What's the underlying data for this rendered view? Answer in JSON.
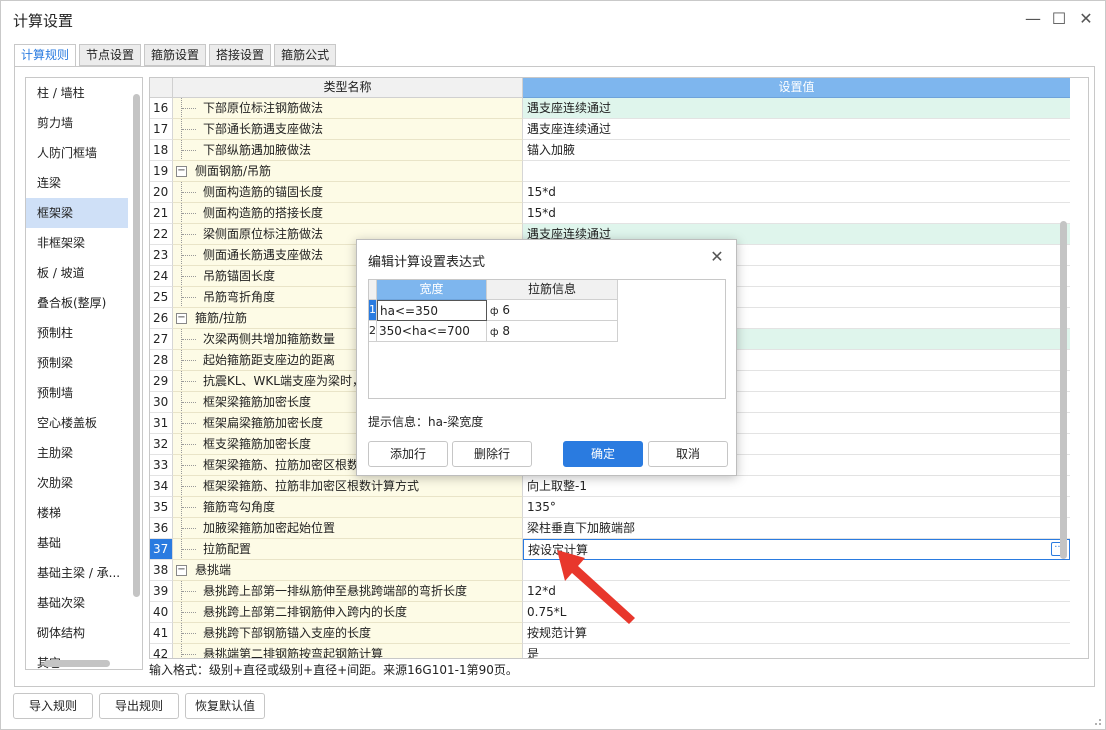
{
  "window": {
    "title": "计算设置",
    "minimize": "—",
    "maximize": "☐",
    "close": "✕"
  },
  "tabs": [
    {
      "label": "计算规则",
      "active": true
    },
    {
      "label": "节点设置",
      "active": false
    },
    {
      "label": "箍筋设置",
      "active": false
    },
    {
      "label": "搭接设置",
      "active": false
    },
    {
      "label": "箍筋公式",
      "active": false
    }
  ],
  "sidebar": {
    "items": [
      "柱 / 墙柱",
      "剪力墙",
      "人防门框墙",
      "连梁",
      "框架梁",
      "非框架梁",
      "板 / 坡道",
      "叠合板(整厚)",
      "预制柱",
      "预制梁",
      "预制墙",
      "空心楼盖板",
      "主肋梁",
      "次肋梁",
      "楼梯",
      "基础",
      "基础主梁 / 承...",
      "基础次梁",
      "砌体结构",
      "其它"
    ],
    "selected_index": 4
  },
  "grid": {
    "header_name": "类型名称",
    "header_value": "设置值",
    "rows": [
      {
        "num": "16",
        "name": "下部原位标注钢筋做法",
        "value": "遇支座连续通过",
        "group": false,
        "modified": true
      },
      {
        "num": "17",
        "name": "下部通长筋遇支座做法",
        "value": "遇支座连续通过",
        "group": false,
        "modified": false
      },
      {
        "num": "18",
        "name": "下部纵筋遇加腋做法",
        "value": "锚入加腋",
        "group": false,
        "modified": false
      },
      {
        "num": "19",
        "name": "侧面钢筋/吊筋",
        "value": "",
        "group": true,
        "modified": false
      },
      {
        "num": "20",
        "name": "侧面构造筋的锚固长度",
        "value": "15*d",
        "group": false,
        "modified": false
      },
      {
        "num": "21",
        "name": "侧面构造筋的搭接长度",
        "value": "15*d",
        "group": false,
        "modified": false
      },
      {
        "num": "22",
        "name": "梁侧面原位标注筋做法",
        "value": "遇支座连续通过",
        "group": false,
        "modified": true
      },
      {
        "num": "23",
        "name": "侧面通长筋遇支座做法",
        "value": "",
        "group": false,
        "modified": false
      },
      {
        "num": "24",
        "name": "吊筋锚固长度",
        "value": "",
        "group": false,
        "modified": false
      },
      {
        "num": "25",
        "name": "吊筋弯折角度",
        "value": "",
        "group": false,
        "modified": false
      },
      {
        "num": "26",
        "name": "箍筋/拉筋",
        "value": "",
        "group": true,
        "modified": false
      },
      {
        "num": "27",
        "name": "次梁两侧共增加箍筋数量",
        "value": "",
        "group": false,
        "modified": true
      },
      {
        "num": "28",
        "name": "起始箍筋距支座边的距离",
        "value": "",
        "group": false,
        "modified": false
      },
      {
        "num": "29",
        "name": "抗震KL、WKL端支座为梁时，",
        "value": "",
        "group": false,
        "modified": false
      },
      {
        "num": "30",
        "name": "框架梁箍筋加密长度",
        "value": "",
        "group": false,
        "modified": false
      },
      {
        "num": "31",
        "name": "框架扁梁箍筋加密长度",
        "value": "",
        "group": false,
        "modified": false
      },
      {
        "num": "32",
        "name": "框支梁箍筋加密长度",
        "value": "",
        "group": false,
        "modified": false
      },
      {
        "num": "33",
        "name": "框架梁箍筋、拉筋加密区根数",
        "value": "",
        "group": false,
        "modified": false
      },
      {
        "num": "34",
        "name": "框架梁箍筋、拉筋非加密区根数计算方式",
        "value": "向上取整-1",
        "group": false,
        "modified": false
      },
      {
        "num": "35",
        "name": "箍筋弯勾角度",
        "value": "135°",
        "group": false,
        "modified": false
      },
      {
        "num": "36",
        "name": "加腋梁箍筋加密起始位置",
        "value": "梁柱垂直下加腋端部",
        "group": false,
        "modified": false
      },
      {
        "num": "37",
        "name": "拉筋配置",
        "value": "按设定计算",
        "group": false,
        "modified": false,
        "current": true
      },
      {
        "num": "38",
        "name": "悬挑端",
        "value": "",
        "group": true,
        "modified": false
      },
      {
        "num": "39",
        "name": "悬挑跨上部第一排纵筋伸至悬挑跨端部的弯折长度",
        "value": "12*d",
        "group": false,
        "modified": false
      },
      {
        "num": "40",
        "name": "悬挑跨上部第二排钢筋伸入跨内的长度",
        "value": "0.75*L",
        "group": false,
        "modified": false
      },
      {
        "num": "41",
        "name": "悬挑跨下部钢筋锚入支座的长度",
        "value": "按规范计算",
        "group": false,
        "modified": false
      },
      {
        "num": "42",
        "name": "悬挑端第二排钢筋按弯起钢筋计算",
        "value": "是",
        "group": false,
        "modified": false
      }
    ]
  },
  "input_hint": "输入格式：级别+直径或级别+直径+间距。来源16G101-1第90页。",
  "bottom_buttons": {
    "import": "导入规则",
    "export": "导出规则",
    "restore": "恢复默认值"
  },
  "dialog": {
    "title": "编辑计算设置表达式",
    "close": "✕",
    "col_width": "宽度",
    "col_tie": "拉筋信息",
    "rows": [
      {
        "num": "1",
        "width": "ha<=350",
        "tie": " 6"
      },
      {
        "num": "2",
        "width": "350<ha<=700",
        "tie": " 8"
      }
    ],
    "hint": "提示信息：ha-梁宽度",
    "add_row": "添加行",
    "delete_row": "删除行",
    "ok": "确定",
    "cancel": "取消"
  },
  "colors": {
    "accent": "#2a7be0",
    "header_highlight": "#7eb6ee",
    "name_cell_bg": "#fdfbe6",
    "modified_bg": "#dff5ec",
    "selected_item_bg": "#cfe0f7",
    "arrow": "#e8372c"
  }
}
